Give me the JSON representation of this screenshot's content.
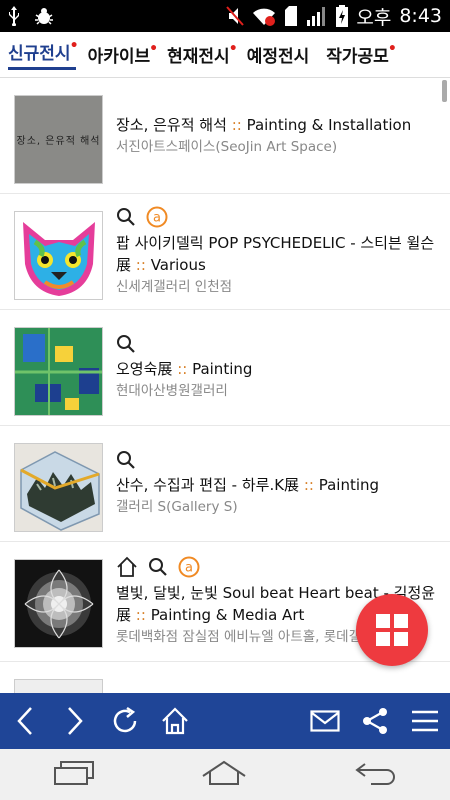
{
  "status_bar": {
    "ampm": "오후",
    "time": "8:43"
  },
  "tabs": [
    {
      "label": "신규전시",
      "dot": "•"
    },
    {
      "label": "아카이브",
      "dot": "•"
    },
    {
      "label": "현재전시",
      "dot": "•"
    },
    {
      "label": "예정전시",
      "dot": ""
    },
    {
      "label": "작가공모",
      "dot": "•"
    }
  ],
  "exhibitions": [
    {
      "title": "장소, 은유적 해석",
      "sep": "::",
      "genre": "Painting & Installation",
      "venue": "서진아트스페이스(SeoJin Art Space)",
      "thumb_text": "장소, 은유적 해석",
      "icons": []
    },
    {
      "title": "팝 사이키델릭 POP PSYCHEDELIC - 스티븐 윌슨展",
      "sep": "::",
      "genre": "Various",
      "venue": "신세계갤러리 인천점",
      "thumb_text": "",
      "icons": [
        "search-icon",
        "at-icon"
      ]
    },
    {
      "title": "오영숙展",
      "sep": "::",
      "genre": "Painting",
      "venue": "현대아산병원갤러리",
      "thumb_text": "",
      "icons": [
        "search-icon"
      ]
    },
    {
      "title": "산수, 수집과 편집 - 하루.K展",
      "sep": "::",
      "genre": "Painting",
      "venue": "갤러리 S(Gallery S)",
      "thumb_text": "",
      "icons": [
        "search-icon"
      ]
    },
    {
      "title": "별빛, 달빛, 눈빛 Soul beat Heart beat - 김정윤展",
      "sep": "::",
      "genre": "Painting & Media Art",
      "venue": "롯데백화점 잠실점 에비뉴엘 아트홀, 롯데갤러리",
      "thumb_text": "",
      "icons": [
        "home-icon",
        "search-icon",
        "at-icon"
      ]
    }
  ],
  "colors": {
    "accent": "#1f3f8f",
    "toolbar": "#1f4597",
    "fab": "#ee3a3f",
    "genre_sep": "#d9822b",
    "dot": "#e0201c"
  }
}
